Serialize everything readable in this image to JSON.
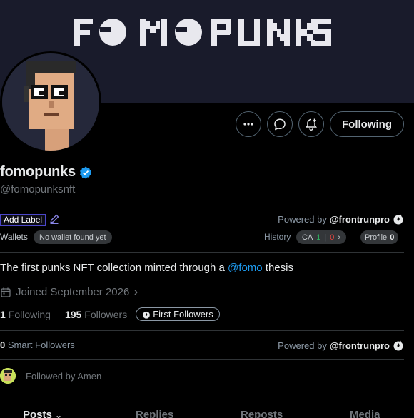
{
  "banner": {
    "text": "FOMOPUNKS"
  },
  "actions": {
    "more_icon": "more-horizontal-icon",
    "message_icon": "message-bubble-icon",
    "notify_icon": "bell-plus-icon",
    "follow_label": "Following"
  },
  "profile": {
    "display_name": "fomopunks",
    "handle": "@fomopunksnft",
    "verified": true,
    "bio_prefix": "The first punks NFT collection minted through a ",
    "bio_mention": "@fomo",
    "bio_suffix": " thesis",
    "joined": "Joined September 2026",
    "following_count": "1",
    "following_label": "Following",
    "followers_count": "195",
    "followers_label": "Followers",
    "first_followers_label": "First Followers",
    "followed_by": "Followed by Amen"
  },
  "extension": {
    "add_label": "Add Label",
    "powered_by_prefix": "Powered by",
    "powered_by_name": "@frontrunpro",
    "wallets_label": "Wallets",
    "wallets_value": "No wallet found yet",
    "history_label": "History",
    "ca_label": "CA",
    "ca_green": "1",
    "ca_sep": "|",
    "ca_red": "0",
    "profile_label": "Profile",
    "profile_count": "0",
    "smart_count": "0",
    "smart_label": "Smart Followers"
  },
  "tabs": [
    {
      "label": "Posts"
    },
    {
      "label": "Replies"
    },
    {
      "label": "Reposts"
    },
    {
      "label": "Media"
    }
  ],
  "colors": {
    "accent_blue": "#1d9bf0",
    "banner_bg": "#191b2b",
    "ca_green": "#2fae5f",
    "ca_red": "#e0453f"
  }
}
